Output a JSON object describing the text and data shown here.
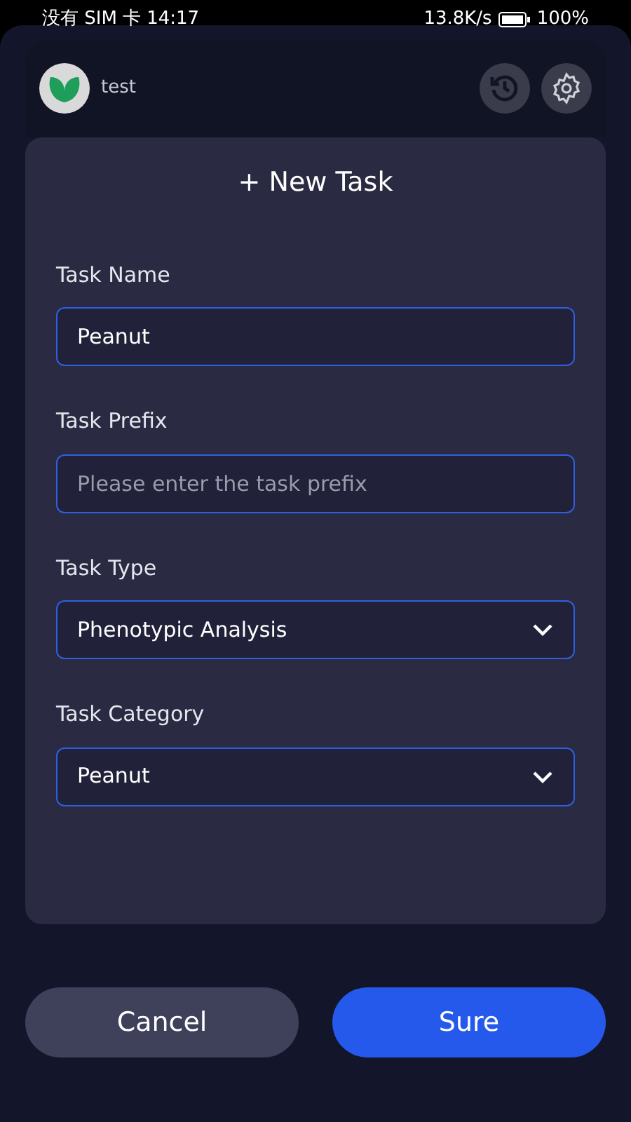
{
  "status_bar": {
    "carrier": "没有 SIM 卡",
    "time": "14:17",
    "speed": "13.8K/s",
    "battery": "100%"
  },
  "header": {
    "user": "test"
  },
  "dialog": {
    "title": "+ New Task",
    "fields": [
      {
        "kind": "input",
        "label": "Task Name",
        "value": "Peanut"
      },
      {
        "kind": "input",
        "label": "Task Prefix",
        "placeholder": "Please enter the task prefix"
      },
      {
        "kind": "select",
        "label": "Task Type",
        "value": "Phenotypic Analysis"
      },
      {
        "kind": "select",
        "label": "Task Category",
        "value": "Peanut"
      }
    ]
  },
  "buttons": [
    {
      "kind": "secondary",
      "label": "Cancel"
    },
    {
      "kind": "primary",
      "label": "Sure"
    }
  ]
}
